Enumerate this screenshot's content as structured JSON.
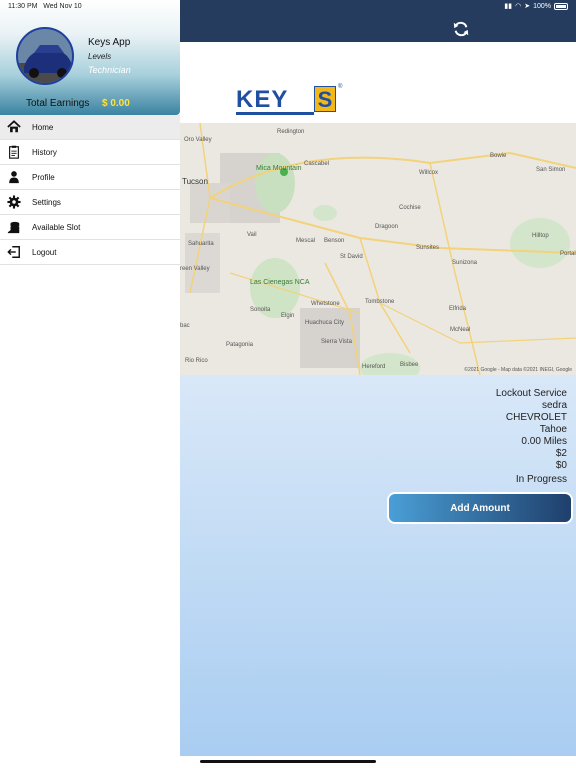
{
  "status_bar": {
    "time": "11:30 PM",
    "date": "Wed Nov 10",
    "battery": "100%"
  },
  "drawer": {
    "app_name": "Keys App",
    "levels": "Levels",
    "role": "Technician",
    "earnings_label": "Total Earnings",
    "earnings_value": "$ 0.00",
    "menu": [
      {
        "label": "Home",
        "icon": "home-icon",
        "active": true
      },
      {
        "label": "History",
        "icon": "history-icon",
        "active": false
      },
      {
        "label": "Profile",
        "icon": "user-icon",
        "active": false
      },
      {
        "label": "Settings",
        "icon": "gear-icon",
        "active": false
      },
      {
        "label": "Available Slot",
        "icon": "coins-icon",
        "active": false
      },
      {
        "label": "Logout",
        "icon": "logout-icon",
        "active": false
      }
    ]
  },
  "header": {
    "refresh_icon": "refresh-icon",
    "logo_text": "KEY",
    "logo_s": "S",
    "logo_reg": "®"
  },
  "map": {
    "labels": {
      "redington": "Redington",
      "oro_valley": "Oro Valley",
      "cascabel": "Cascabel",
      "mica_mountain": "Mica Mountain",
      "tucson": "Tucson",
      "willcox": "Willcox",
      "bowie": "Bowie",
      "san_simon": "San Simon",
      "cochise": "Cochise",
      "dragoon": "Dragoon",
      "vail": "Vail",
      "mescal": "Mescal",
      "benson": "Benson",
      "sahuarita": "Sahuarita",
      "sunsites": "Sunsites",
      "hilltop": "Hilltop",
      "st_david": "St David",
      "sunizona": "Sunizona",
      "green_valley": "reen Valley",
      "las_cienegas": "Las Cienegas NCA",
      "portal": "Portal",
      "whetstone": "Whetstone",
      "tombstone": "Tombstone",
      "sonoita": "Sonoita",
      "elgin": "Elgin",
      "elfrida": "Elfrida",
      "huachuca": "Huachuca City",
      "bac": "bac",
      "mcneal": "McNeal",
      "patagonia": "Patagonia",
      "sierra_vista": "Sierra Vista",
      "rio_rico": "Rio Rico",
      "hereford": "Hereford",
      "bisbee": "Bisbee"
    },
    "copyright": "©2021 Google - Map data ©2021 INEGI, Google"
  },
  "job": {
    "service": "Lockout Service",
    "customer": "sedra",
    "make": "CHEVROLET",
    "model": "Tahoe",
    "distance": "0.00 Miles",
    "price": "$2",
    "extra": "$0",
    "status": "In Progress",
    "add_amount_label": "Add Amount"
  }
}
